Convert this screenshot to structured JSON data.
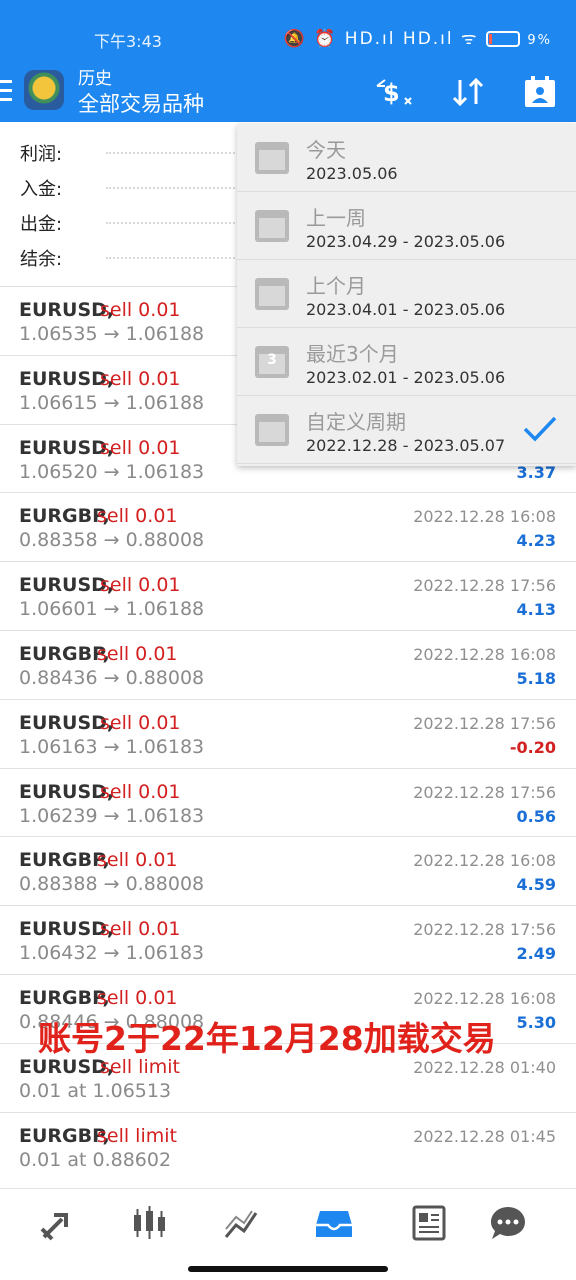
{
  "status_bar": {
    "time": "下午3:43",
    "icons_text": "🔕 ⏰ HD.ıl HD.ıl ᯤ",
    "battery": "9%"
  },
  "app_bar": {
    "title": "历史",
    "subtitle": "全部交易品种",
    "actions": [
      "currency-filter-icon",
      "sort-icon",
      "calendar-icon"
    ]
  },
  "summary": {
    "profit_label": "利润:",
    "deposit_label": "入金:",
    "withdrawal_label": "出金:",
    "balance_label": "结余:"
  },
  "period_menu": {
    "items": [
      {
        "label": "今天",
        "range": "2023.05.06",
        "icon": "calendar-day-icon"
      },
      {
        "label": "上一周",
        "range": "2023.04.29 - 2023.05.06",
        "icon": "calendar-week-icon"
      },
      {
        "label": "上个月",
        "range": "2023.04.01 - 2023.05.06",
        "icon": "calendar-month-icon"
      },
      {
        "label": "最近3个月",
        "range": "2023.02.01 - 2023.05.06",
        "icon": "calendar-3-icon",
        "icon_number": "3"
      },
      {
        "label": "自定义周期",
        "range": "2022.12.28 - 2023.05.07",
        "icon": "calendar-custom-icon",
        "selected": true
      }
    ]
  },
  "trades": [
    {
      "symbol": "EURUSD,",
      "side": "sell 0.01",
      "price": "1.06535 → 1.06188",
      "date": "",
      "profit": ""
    },
    {
      "symbol": "EURUSD,",
      "side": "sell 0.01",
      "price": "1.06615 → 1.06188",
      "date": "",
      "profit": ""
    },
    {
      "symbol": "EURUSD,",
      "side": "sell 0.01",
      "price": "1.06520 → 1.06183",
      "date": "",
      "profit": "3.37"
    },
    {
      "symbol": "EURGBP,",
      "side": "sell 0.01",
      "price": "0.88358 → 0.88008",
      "date": "2022.12.28 16:08",
      "profit": "4.23"
    },
    {
      "symbol": "EURUSD,",
      "side": "sell 0.01",
      "price": "1.06601 → 1.06188",
      "date": "2022.12.28 17:56",
      "profit": "4.13"
    },
    {
      "symbol": "EURGBP,",
      "side": "sell 0.01",
      "price": "0.88436 → 0.88008",
      "date": "2022.12.28 16:08",
      "profit": "5.18"
    },
    {
      "symbol": "EURUSD,",
      "side": "sell 0.01",
      "price": "1.06163 → 1.06183",
      "date": "2022.12.28 17:56",
      "profit": "-0.20"
    },
    {
      "symbol": "EURUSD,",
      "side": "sell 0.01",
      "price": "1.06239 → 1.06183",
      "date": "2022.12.28 17:56",
      "profit": "0.56"
    },
    {
      "symbol": "EURGBP,",
      "side": "sell 0.01",
      "price": "0.88388 → 0.88008",
      "date": "2022.12.28 16:08",
      "profit": "4.59"
    },
    {
      "symbol": "EURUSD,",
      "side": "sell 0.01",
      "price": "1.06432 → 1.06183",
      "date": "2022.12.28 17:56",
      "profit": "2.49"
    },
    {
      "symbol": "EURGBP,",
      "side": "sell 0.01",
      "price": "0.88446 → 0.88008",
      "date": "2022.12.28 16:08",
      "profit": "5.30"
    },
    {
      "symbol": "EURUSD,",
      "side": "sell limit",
      "price": "0.01 at 1.06513",
      "date": "2022.12.28 01:40",
      "profit": ""
    },
    {
      "symbol": "EURGBP,",
      "side": "sell limit",
      "price": "0.01 at 0.88602",
      "date": "2022.12.28 01:45",
      "profit": ""
    }
  ],
  "overlay_caption": "账号2于22年12月28加载交易",
  "bottom_nav": [
    "trade-icon",
    "chart-candles-icon",
    "analytics-icon",
    "history-icon",
    "news-icon",
    "chat-icon"
  ],
  "colors": {
    "brand_blue": "#1e88f0",
    "sell_red": "#d32020",
    "profit_blue": "#1a6fd6",
    "caption_red": "#e0221b"
  }
}
